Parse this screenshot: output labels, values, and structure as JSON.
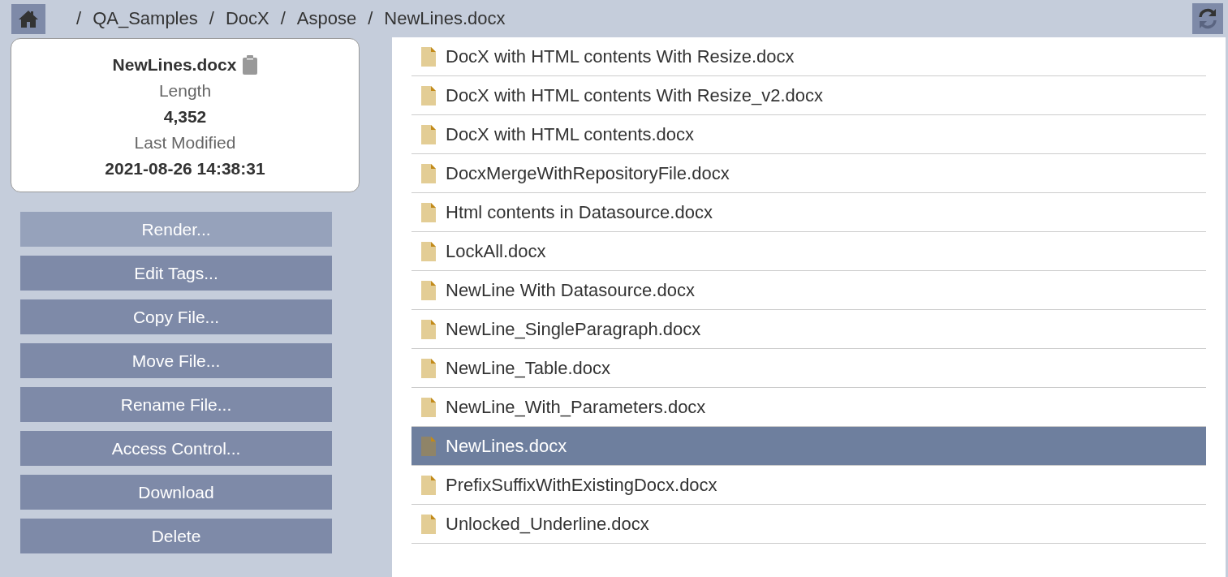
{
  "breadcrumb": {
    "separator": "/",
    "items": [
      "QA_Samples",
      "DocX",
      "Aspose",
      "NewLines.docx"
    ]
  },
  "details": {
    "name": "NewLines.docx",
    "length_label": "Length",
    "length": "4,352",
    "modified_label": "Last Modified",
    "modified": "2021-08-26 14:38:31"
  },
  "actions": [
    {
      "label": "Render...",
      "highlighted": true
    },
    {
      "label": "Edit Tags...",
      "highlighted": false
    },
    {
      "label": "Copy File...",
      "highlighted": false
    },
    {
      "label": "Move File...",
      "highlighted": false
    },
    {
      "label": "Rename File...",
      "highlighted": false
    },
    {
      "label": "Access Control...",
      "highlighted": false
    },
    {
      "label": "Download",
      "highlighted": false
    },
    {
      "label": "Delete",
      "highlighted": false
    }
  ],
  "files": [
    {
      "name": "DocX with HTML contents With Resize.docx",
      "selected": false
    },
    {
      "name": "DocX with HTML contents With Resize_v2.docx",
      "selected": false
    },
    {
      "name": "DocX with HTML contents.docx",
      "selected": false
    },
    {
      "name": "DocxMergeWithRepositoryFile.docx",
      "selected": false
    },
    {
      "name": "Html contents in Datasource.docx",
      "selected": false
    },
    {
      "name": "LockAll.docx",
      "selected": false
    },
    {
      "name": "NewLine With Datasource.docx",
      "selected": false
    },
    {
      "name": "NewLine_SingleParagraph.docx",
      "selected": false
    },
    {
      "name": "NewLine_Table.docx",
      "selected": false
    },
    {
      "name": "NewLine_With_Parameters.docx",
      "selected": false
    },
    {
      "name": "NewLines.docx",
      "selected": true
    },
    {
      "name": "PrefixSuffixWithExistingDocx.docx",
      "selected": false
    },
    {
      "name": "Unlocked_Underline.docx",
      "selected": false
    }
  ]
}
